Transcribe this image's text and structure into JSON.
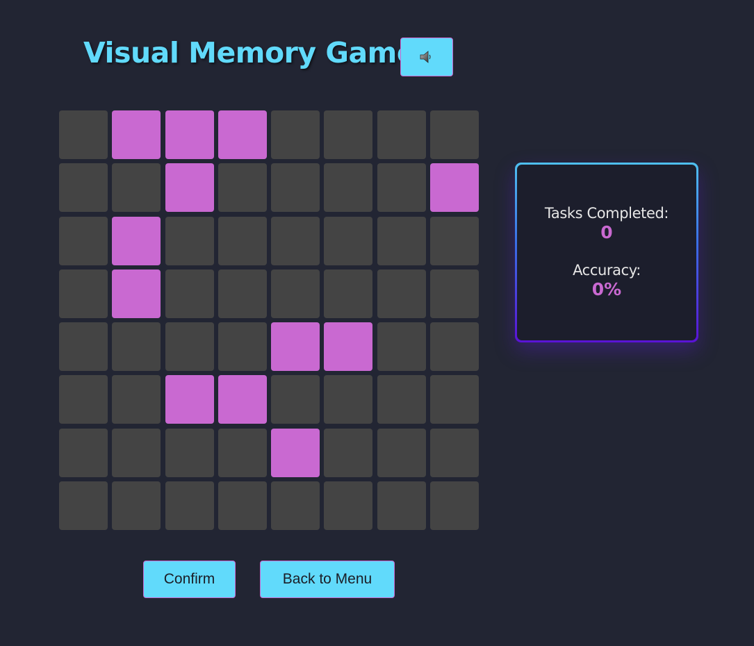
{
  "header": {
    "title": "Visual Memory Game",
    "sound_icon": "speaker-muted-icon"
  },
  "board": {
    "rows": 8,
    "cols": 8,
    "cell_color": "#444444",
    "active_color": "#c969d1",
    "active_cells": [
      [
        0,
        1
      ],
      [
        0,
        2
      ],
      [
        0,
        3
      ],
      [
        1,
        2
      ],
      [
        1,
        7
      ],
      [
        2,
        1
      ],
      [
        3,
        1
      ],
      [
        4,
        4
      ],
      [
        4,
        5
      ],
      [
        5,
        2
      ],
      [
        5,
        3
      ],
      [
        6,
        4
      ]
    ]
  },
  "stats": {
    "tasks_label": "Tasks Completed:",
    "tasks_value": "0",
    "accuracy_label": "Accuracy:",
    "accuracy_value": "0%"
  },
  "actions": {
    "confirm_label": "Confirm",
    "menu_label": "Back to Menu"
  },
  "colors": {
    "background": "#222533",
    "accent": "#61dafb",
    "highlight": "#c969d1"
  }
}
